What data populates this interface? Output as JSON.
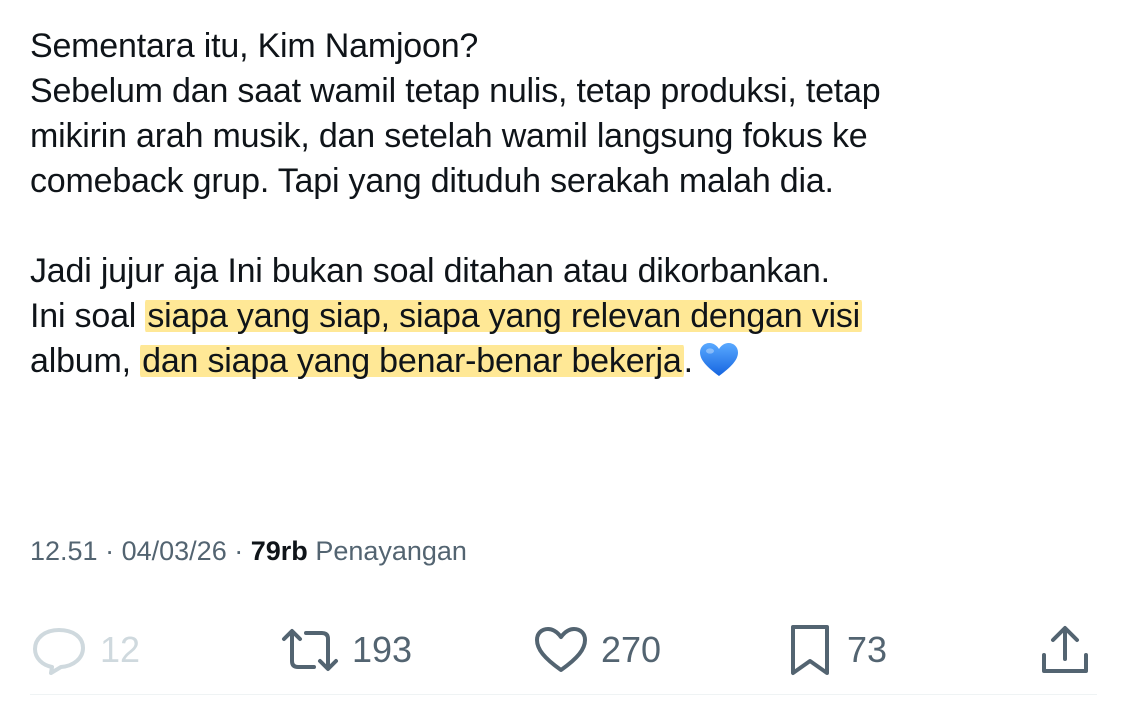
{
  "tweet": {
    "lines": [
      "Sementara itu, Kim Namjoon?",
      "Sebelum dan saat wamil tetap nulis, tetap produksi, tetap",
      "mikirin arah musik, dan setelah wamil langsung fokus ke",
      "comeback grup. Tapi yang dituduh serakah malah dia.",
      "Jadi jujur aja Ini bukan soal ditahan atau dikorbankan."
    ],
    "line6_prefix": "Ini soal ",
    "line6_highlight": "siapa yang siap, siapa yang relevan dengan visi",
    "line7_prefix": "album, ",
    "line7_highlight": "dan siapa yang benar-benar bekerja",
    "line7_suffix": ".",
    "emoji": "blue-heart-emoji",
    "highlight_color": "#ffd640"
  },
  "meta": {
    "time": "12.51",
    "separator": "·",
    "date": "04/03/26",
    "views_count": "79rb",
    "views_label": "Penayangan"
  },
  "actions": {
    "reply_count": "12",
    "retweet_count": "193",
    "like_count": "270",
    "bookmark_count": "73"
  },
  "colors": {
    "text": "#0f1419",
    "secondary": "#536471",
    "disabled": "#cfd9de"
  }
}
